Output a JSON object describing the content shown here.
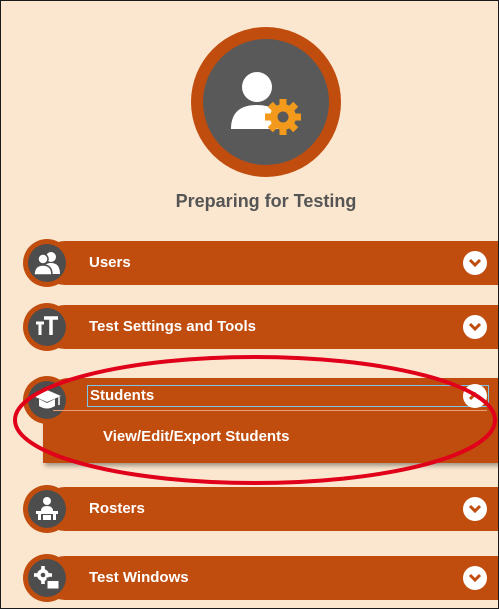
{
  "page": {
    "title": "Preparing for Testing"
  },
  "nav": {
    "users": {
      "label": "Users",
      "icon": "users-icon",
      "state": "collapsed"
    },
    "test_settings": {
      "label": "Test Settings and Tools",
      "icon": "text-size-icon",
      "state": "collapsed"
    },
    "students": {
      "label": "Students",
      "icon": "graduation-cap-icon",
      "state": "expanded",
      "items": [
        {
          "label": "View/Edit/Export Students"
        }
      ]
    },
    "rosters": {
      "label": "Rosters",
      "icon": "classroom-icon",
      "state": "collapsed"
    },
    "test_windows": {
      "label": "Test Windows",
      "icon": "calendar-gear-icon",
      "state": "collapsed"
    }
  },
  "colors": {
    "background": "#fbe7cf",
    "accent": "#c04d0e",
    "icon_disc": "#4d4d4d",
    "highlight": "#e0001a"
  }
}
